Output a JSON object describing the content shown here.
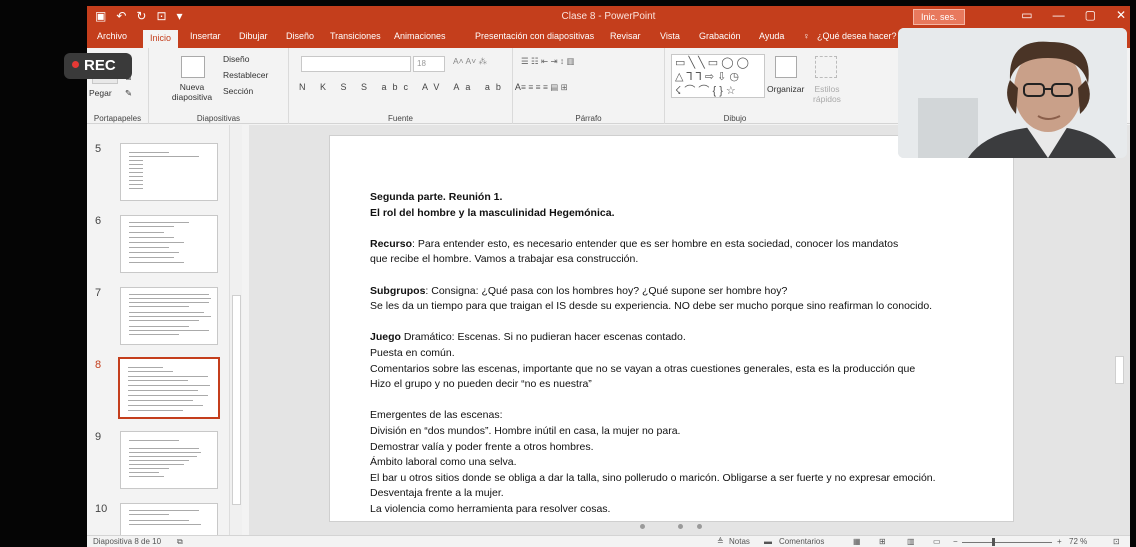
{
  "rec": {
    "label": "REC",
    "color": "#e53935"
  },
  "window": {
    "title": "Clase 8  -  PowerPoint",
    "sign_in": "Inic. ses.",
    "accent": "#c43e1c"
  },
  "tabs": [
    "Archivo",
    "Inicio",
    "Insertar",
    "Dibujar",
    "Diseño",
    "Transiciones",
    "Animaciones",
    "Presentación con diapositivas",
    "Revisar",
    "Vista",
    "Grabación",
    "Ayuda"
  ],
  "tell_me": "¿Qué desea hacer?",
  "ribbon": {
    "portapapeles": {
      "label": "Portapapeles",
      "paste": "Pegar"
    },
    "diapositivas": {
      "label": "Diapositivas",
      "new_slide": "Nueva diapositiva",
      "layout": "Diseño",
      "reset": "Restablecer",
      "section": "Sección"
    },
    "fuente": {
      "label": "Fuente",
      "size": "18"
    },
    "parrafo": {
      "label": "Párrafo"
    },
    "dibujo": {
      "label": "Dibujo",
      "arrange": "Organizar",
      "quick_styles": "Estilos rápidos"
    }
  },
  "thumbnails": [
    {
      "num": "5",
      "selected": false,
      "title": "Segunda parte. Reunión 1."
    },
    {
      "num": "6",
      "selected": false,
      "title": "Segunda parte. Reunión 1."
    },
    {
      "num": "7",
      "selected": false,
      "title": "Segunda parte. Reunión 1."
    },
    {
      "num": "8",
      "selected": true,
      "title": "Segunda parte. Reunión 1."
    },
    {
      "num": "9",
      "selected": false,
      "title": "Segunda parte. Reunión 1."
    },
    {
      "num": "10",
      "selected": false,
      "title": "Segunda parte. Reunión 1."
    }
  ],
  "slide": {
    "title1": "Segunda parte. Reunión 1.",
    "title2": "El rol del hombre y la masculinidad Hegemónica.",
    "recurso_label": "Recurso",
    "recurso_l1": ": Para entender esto, es necesario entender que es ser hombre en esta sociedad, conocer los mandatos",
    "recurso_l2": "que recibe el hombre. Vamos a trabajar esa construcción.",
    "subgrupos_label": "Subgrupos",
    "subgrupos_l1": ": Consigna: ¿Qué pasa con los hombres hoy? ¿Qué supone ser hombre hoy?",
    "subgrupos_l2": "Se les da un tiempo para que traigan el IS desde su experiencia. NO debe ser mucho porque sino reafirman lo conocido.",
    "juego_label": "Juego",
    "juego_l1": " Dramático: Escenas. Si no pudieran hacer escenas contado.",
    "juego_l2": "Puesta en común.",
    "juego_l3": "Comentarios sobre las escenas, importante que no se vayan a otras cuestiones generales, esta es la producción que",
    "juego_l4": "Hizo el grupo y no pueden decir “no es nuestra”",
    "emergentes": [
      "Emergentes de las escenas:",
      "División en “dos mundos”. Hombre inútil en casa, la mujer no para.",
      "Demostrar valía y poder frente a otros hombres.",
      "Ámbito laboral como una selva.",
      "El bar u otros sitios donde se obliga a dar la talla, sino pollerudo o maricón. Obligarse a ser fuerte y no expresar emoción.",
      "Desventaja frente a la mujer.",
      "La violencia como herramienta para resolver cosas."
    ]
  },
  "status": {
    "slide_info": "Diapositiva 8 de 10",
    "notes": "Notas",
    "comments": "Comentarios",
    "zoom": "72 %"
  }
}
